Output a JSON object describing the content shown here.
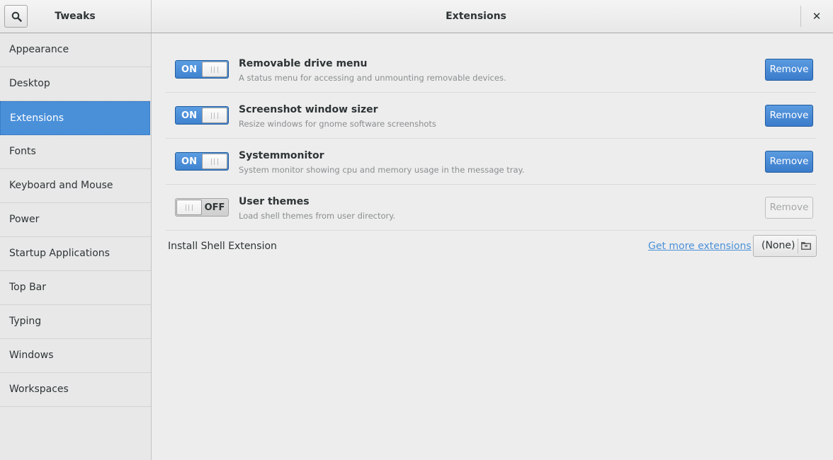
{
  "header": {
    "app_title": "Tweaks",
    "page_title": "Extensions",
    "search_icon": "search-icon",
    "close_icon": "close-icon",
    "close_glyph": "✕"
  },
  "sidebar": {
    "items": [
      {
        "label": "Appearance",
        "selected": false
      },
      {
        "label": "Desktop",
        "selected": false
      },
      {
        "label": "Extensions",
        "selected": true
      },
      {
        "label": "Fonts",
        "selected": false
      },
      {
        "label": "Keyboard and Mouse",
        "selected": false
      },
      {
        "label": "Power",
        "selected": false
      },
      {
        "label": "Startup Applications",
        "selected": false
      },
      {
        "label": "Top Bar",
        "selected": false
      },
      {
        "label": "Typing",
        "selected": false
      },
      {
        "label": "Windows",
        "selected": false
      },
      {
        "label": "Workspaces",
        "selected": false
      }
    ]
  },
  "extensions": [
    {
      "name": "Removable drive menu",
      "description": "A status menu for accessing and unmounting removable devices.",
      "switch_label": "ON",
      "enabled": true,
      "remove_label": "Remove",
      "remove_enabled": true
    },
    {
      "name": "Screenshot window sizer",
      "description": "Resize windows for gnome software screenshots",
      "switch_label": "ON",
      "enabled": true,
      "remove_label": "Remove",
      "remove_enabled": true
    },
    {
      "name": "Systemmonitor",
      "description": "System monitor showing cpu and memory usage in the message tray.",
      "switch_label": "ON",
      "enabled": true,
      "remove_label": "Remove",
      "remove_enabled": true
    },
    {
      "name": "User themes",
      "description": "Load shell themes from user directory.",
      "switch_label": "OFF",
      "enabled": false,
      "remove_label": "Remove",
      "remove_enabled": false
    }
  ],
  "install": {
    "label": "Install Shell Extension",
    "link_text": "Get more extensions",
    "file_chooser_value": "(None)",
    "file_chooser_icon": "folder-icon"
  },
  "colors": {
    "accent": "#4a90d9",
    "background": "#ededed"
  }
}
